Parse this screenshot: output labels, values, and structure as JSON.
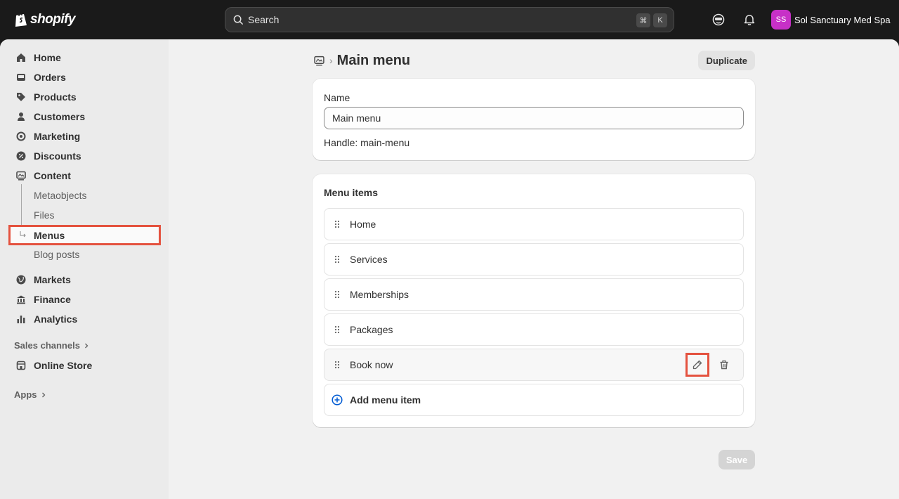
{
  "topbar": {
    "logo_text": "shopify",
    "search_placeholder": "Search",
    "shortcut_cmd": "⌘",
    "shortcut_key": "K",
    "store_initials": "SS",
    "store_name": "Sol Sanctuary Med Spa"
  },
  "sidebar": {
    "items": [
      {
        "label": "Home",
        "icon": "home-icon"
      },
      {
        "label": "Orders",
        "icon": "inbox-icon"
      },
      {
        "label": "Products",
        "icon": "tag-icon"
      },
      {
        "label": "Customers",
        "icon": "person-icon"
      },
      {
        "label": "Marketing",
        "icon": "target-icon"
      },
      {
        "label": "Discounts",
        "icon": "discount-icon"
      },
      {
        "label": "Content",
        "icon": "content-icon"
      }
    ],
    "content_sub": [
      {
        "label": "Metaobjects"
      },
      {
        "label": "Files"
      },
      {
        "label": "Menus",
        "active": true
      },
      {
        "label": "Blog posts"
      }
    ],
    "items2": [
      {
        "label": "Markets",
        "icon": "globe-icon"
      },
      {
        "label": "Finance",
        "icon": "bank-icon"
      },
      {
        "label": "Analytics",
        "icon": "bar-chart-icon"
      }
    ],
    "sales_channels_label": "Sales channels",
    "online_store_label": "Online Store",
    "apps_label": "Apps"
  },
  "page": {
    "title": "Main menu",
    "duplicate_label": "Duplicate",
    "name_label": "Name",
    "name_value": "Main menu",
    "handle_text": "Handle: main-menu",
    "menu_items_title": "Menu items",
    "menu_items": [
      "Home",
      "Services",
      "Memberships",
      "Packages",
      "Book now"
    ],
    "add_item_label": "Add menu item",
    "save_label": "Save"
  },
  "colors": {
    "accent": "#e4523f",
    "avatar": "#c730c7",
    "link": "#005bd3"
  }
}
